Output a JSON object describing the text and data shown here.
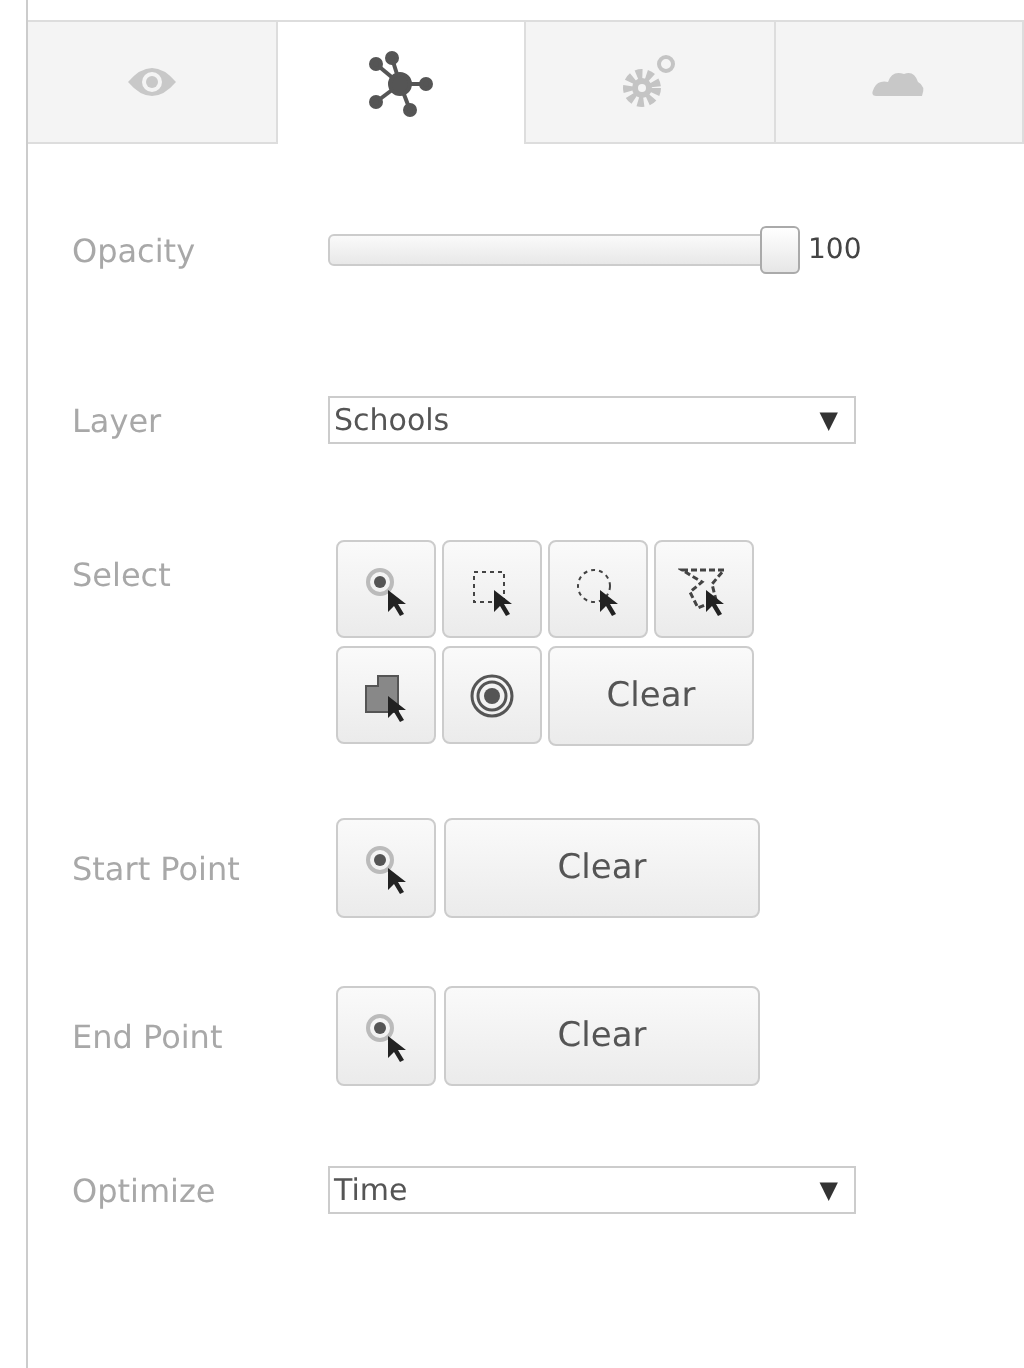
{
  "tabs": [
    {
      "kind": "eye",
      "selected": false
    },
    {
      "kind": "network",
      "selected": true
    },
    {
      "kind": "gears",
      "selected": false
    },
    {
      "kind": "cloud",
      "selected": false
    }
  ],
  "opacity": {
    "label": "Opacity",
    "level": 1,
    "reading": "100"
  },
  "layer": {
    "label": "Layer",
    "value": "Schools",
    "arrow": "▼"
  },
  "select": {
    "label": "Select",
    "tools": [
      {
        "kind": "point"
      },
      {
        "kind": "rectangle"
      },
      {
        "kind": "circle"
      },
      {
        "kind": "lasso"
      },
      {
        "kind": "polygon"
      },
      {
        "kind": "buffer"
      }
    ],
    "clear": "Clear"
  },
  "start_point": {
    "label": "Start Point",
    "clear": "Clear"
  },
  "end_point": {
    "label": "End Point",
    "clear": "Clear"
  },
  "optimize": {
    "label": "Optimize",
    "value": "Time",
    "arrow": "▼"
  }
}
